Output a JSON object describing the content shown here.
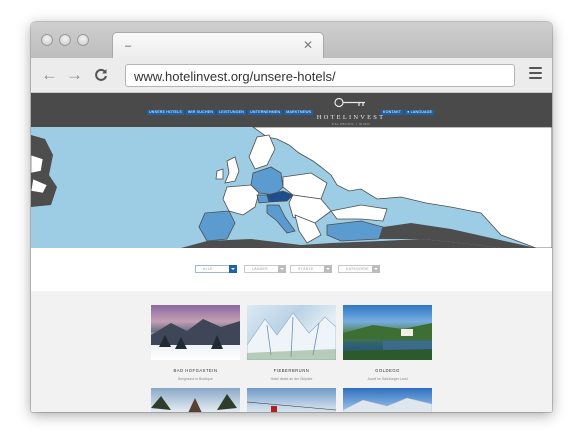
{
  "browser": {
    "tab_title": "–",
    "tab_close": "✕",
    "url": "www.hotelinvest.org/unsere-hotels/",
    "back_glyph": "←",
    "forward_glyph": "→",
    "reload_glyph": "C"
  },
  "site": {
    "logo_brand": "HOTELINVEST",
    "logo_sub": "SALZBURG | WIEN",
    "nav": [
      "UNSERE HOTELS",
      "WIR SUCHEN",
      "LEISTUNGEN",
      "UNTERNEHMEN",
      "MARKTNEWS"
    ],
    "util_nav": [
      "KONTAKT",
      "● LANGUAGE"
    ],
    "accent_color": "#1e61a8",
    "header_color": "#4a4a4a",
    "map_sea_color": "#9ccde5",
    "map_highlight_color": "#5b9bd0",
    "map_selected_color": "#1f4e8c",
    "map_land_dark_color": "#4d4d4d"
  },
  "filters": [
    {
      "label": "ALLE"
    },
    {
      "label": "LÄNDER"
    },
    {
      "label": "STÄDTE"
    },
    {
      "label": "KATEGORIE"
    }
  ],
  "hotels": [
    {
      "name": "BAD HOFGASTEIN",
      "desc": "Bergmund in Boutique"
    },
    {
      "name": "FIEBERBRUNN",
      "desc": "Hotel direkt an der Skipiste"
    },
    {
      "name": "GOLDEGG",
      "desc": "Juwel im Salzburger Land"
    },
    {
      "name": "",
      "desc": ""
    },
    {
      "name": "",
      "desc": ""
    },
    {
      "name": "",
      "desc": ""
    }
  ]
}
